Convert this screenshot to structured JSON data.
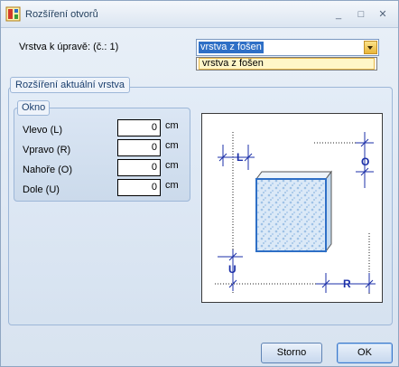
{
  "window": {
    "title": "Rozšíření otvorů",
    "controls": {
      "minimize": "_",
      "maximize": "□",
      "close": "✕"
    }
  },
  "layer": {
    "label": "Vrstva k úpravě: (č.: 1)",
    "selected_value": "vrstva z fošen",
    "options": [
      "vrstva z fošen"
    ]
  },
  "group_layer": {
    "title": "Rozšíření aktuální vrstva"
  },
  "group_window": {
    "title": "Okno",
    "fields": [
      {
        "label": "Vlevo (L)",
        "value": "0",
        "unit": "cm"
      },
      {
        "label": "Vpravo (R)",
        "value": "0",
        "unit": "cm"
      },
      {
        "label": "Nahoře (O)",
        "value": "0",
        "unit": "cm"
      },
      {
        "label": "Dole (U)",
        "value": "0",
        "unit": "cm"
      }
    ]
  },
  "preview": {
    "labels": {
      "left": "L",
      "top": "O",
      "bottom": "U",
      "right": "R"
    },
    "colors": {
      "dimension": "#1b2fa8",
      "panel_fill": "#b7d4ef",
      "panel_edge": "#2e6fc6"
    }
  },
  "buttons": {
    "cancel": "Storno",
    "ok": "OK"
  },
  "colors": {
    "accent": "#2e6fc6",
    "frame": "#9db7d8"
  }
}
